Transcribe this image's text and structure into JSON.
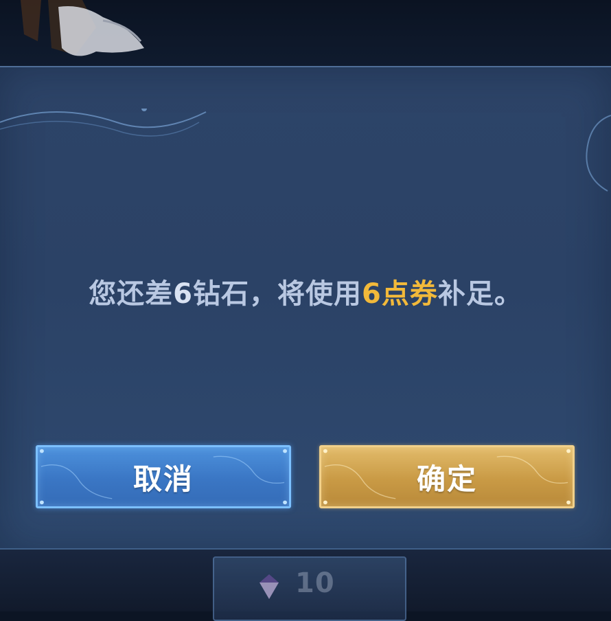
{
  "dialog": {
    "message": {
      "part1": "您还差",
      "diamond_count": "6",
      "part2": "钻石，将使用",
      "voucher_amount": "6点券",
      "part3": "补足。"
    },
    "cancel_label": "取消",
    "confirm_label": "确定"
  },
  "background": {
    "bottom_count": "10"
  },
  "colors": {
    "dialog_bg": "#2d4468",
    "message_text": "#b9c8e2",
    "highlight": "#f2b93a",
    "cancel_button": "#3a76c4",
    "confirm_button": "#c99a45"
  },
  "icons": [
    "gem-icon"
  ]
}
